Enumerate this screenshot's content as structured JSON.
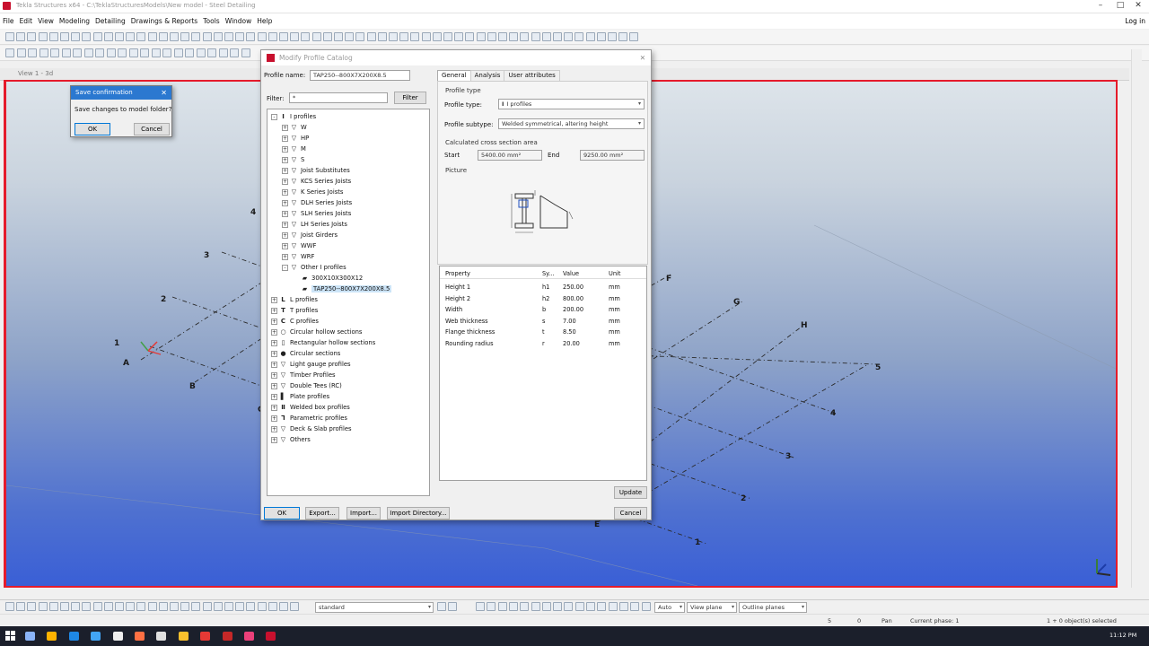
{
  "window": {
    "title": "Tekla Structures x64 - C:\\TeklaStructuresModels\\New model - Steel Detailing",
    "min": "–",
    "max": "□",
    "close": "✕"
  },
  "menu": {
    "items": [
      "File",
      "Edit",
      "View",
      "Modeling",
      "Detailing",
      "Drawings & Reports",
      "Tools",
      "Window",
      "Help"
    ],
    "login": "Log in"
  },
  "view": {
    "tab_title": "View 1 - 3d"
  },
  "grid_labels": {
    "letters": [
      "A",
      "B",
      "C",
      "E",
      "F",
      "G",
      "H"
    ],
    "numbers": [
      "1",
      "2",
      "3",
      "4",
      "1",
      "2",
      "3",
      "4",
      "5"
    ]
  },
  "save_dialog": {
    "title": "Save confirmation",
    "message": "Save changes to model folder?",
    "ok": "OK",
    "cancel": "Cancel",
    "close": "✕"
  },
  "catalog_dialog": {
    "title": "Modify Profile Catalog",
    "close": "✕",
    "profile_name_label": "Profile name:",
    "profile_name_value": "TAP250--800X7X200X8.5",
    "filter_label": "Filter:",
    "filter_value": "*",
    "filter_button": "Filter",
    "tabs": [
      "General",
      "Analysis",
      "User attributes"
    ],
    "tree": [
      {
        "label": "I profiles",
        "icon": "I",
        "level": 0,
        "expand": "-"
      },
      {
        "label": "W",
        "icon": "▽",
        "level": 1,
        "expand": "+"
      },
      {
        "label": "HP",
        "icon": "▽",
        "level": 1,
        "expand": "+"
      },
      {
        "label": "M",
        "icon": "▽",
        "level": 1,
        "expand": "+"
      },
      {
        "label": "S",
        "icon": "▽",
        "level": 1,
        "expand": "+"
      },
      {
        "label": "Joist Substitutes",
        "icon": "▽",
        "level": 1,
        "expand": "+"
      },
      {
        "label": "KCS Series Joists",
        "icon": "▽",
        "level": 1,
        "expand": "+"
      },
      {
        "label": "K Series Joists",
        "icon": "▽",
        "level": 1,
        "expand": "+"
      },
      {
        "label": "DLH Series Joists",
        "icon": "▽",
        "level": 1,
        "expand": "+"
      },
      {
        "label": "SLH Series Joists",
        "icon": "▽",
        "level": 1,
        "expand": "+"
      },
      {
        "label": "LH Series Joists",
        "icon": "▽",
        "level": 1,
        "expand": "+"
      },
      {
        "label": "Joist Girders",
        "icon": "▽",
        "level": 1,
        "expand": "+"
      },
      {
        "label": "WWF",
        "icon": "▽",
        "level": 1,
        "expand": "+"
      },
      {
        "label": "WRF",
        "icon": "▽",
        "level": 1,
        "expand": "+"
      },
      {
        "label": "Other I profiles",
        "icon": "▽",
        "level": 1,
        "expand": "-"
      },
      {
        "label": "300X10X300X12",
        "icon": "▰",
        "level": 2,
        "expand": ""
      },
      {
        "label": "TAP250--800X7X200X8.5",
        "icon": "▰",
        "level": 2,
        "expand": "",
        "selected": true
      },
      {
        "label": "L profiles",
        "icon": "L",
        "level": 0,
        "expand": "+"
      },
      {
        "label": "T profiles",
        "icon": "T",
        "level": 0,
        "expand": "+"
      },
      {
        "label": "C profiles",
        "icon": "C",
        "level": 0,
        "expand": "+"
      },
      {
        "label": "Circular hollow sections",
        "icon": "○",
        "level": 0,
        "expand": "+"
      },
      {
        "label": "Rectangular hollow sections",
        "icon": "▯",
        "level": 0,
        "expand": "+"
      },
      {
        "label": "Circular sections",
        "icon": "●",
        "level": 0,
        "expand": "+"
      },
      {
        "label": "Light gauge profiles",
        "icon": "▽",
        "level": 0,
        "expand": "+"
      },
      {
        "label": "Timber Profiles",
        "icon": "▽",
        "level": 0,
        "expand": "+"
      },
      {
        "label": "Double Tees (RC)",
        "icon": "▽",
        "level": 0,
        "expand": "+"
      },
      {
        "label": "Plate profiles",
        "icon": "▌",
        "level": 0,
        "expand": "+"
      },
      {
        "label": "Welded box profiles",
        "icon": "Ⅱ",
        "level": 0,
        "expand": "+"
      },
      {
        "label": "Parametric profiles",
        "icon": "Ꞁ",
        "level": 0,
        "expand": "+"
      },
      {
        "label": "Deck & Slab profiles",
        "icon": "▽",
        "level": 0,
        "expand": "+"
      },
      {
        "label": "Others",
        "icon": "▽",
        "level": 0,
        "expand": "+"
      }
    ],
    "general": {
      "profile_type_group": "Profile type",
      "profile_type_label": "Profile type:",
      "profile_type_value": "I profiles",
      "profile_subtype_label": "Profile subtype:",
      "profile_subtype_value": "Welded symmetrical, altering height",
      "area_group": "Calculated cross section area",
      "start_label": "Start",
      "start_value": "5400.00 mm²",
      "end_label": "End",
      "end_value": "9250.00 mm²",
      "picture_label": "Picture"
    },
    "props_header": {
      "property": "Property",
      "symbol": "Sy...",
      "value": "Value",
      "unit": "Unit"
    },
    "props": [
      {
        "property": "Height 1",
        "symbol": "h1",
        "value": "250.00",
        "unit": "mm"
      },
      {
        "property": "Height 2",
        "symbol": "h2",
        "value": "800.00",
        "unit": "mm"
      },
      {
        "property": "Width",
        "symbol": "b",
        "value": "200.00",
        "unit": "mm"
      },
      {
        "property": "Web thickness",
        "symbol": "s",
        "value": "7.00",
        "unit": "mm"
      },
      {
        "property": "Flange thickness",
        "symbol": "t",
        "value": "8.50",
        "unit": "mm"
      },
      {
        "property": "Rounding radius",
        "symbol": "r",
        "value": "20.00",
        "unit": "mm"
      }
    ],
    "buttons": {
      "update": "Update",
      "ok": "OK",
      "export": "Export...",
      "import": "Import...",
      "import_dir": "Import Directory...",
      "cancel": "Cancel"
    }
  },
  "bottom_toolbar": {
    "select_value": "standard",
    "snap_auto": "Auto",
    "plane": "View plane",
    "outline": "Outline planes"
  },
  "status": {
    "x": "5",
    "y": "0",
    "mode": "Pan",
    "phase": "Current phase: 1",
    "selection": "1 + 0 object(s) selected"
  },
  "taskbar": {
    "time": "11:12 PM"
  },
  "colors": {
    "accent": "#2b78d0",
    "view_border": "#e51b2b",
    "brand": "#c8102e"
  }
}
